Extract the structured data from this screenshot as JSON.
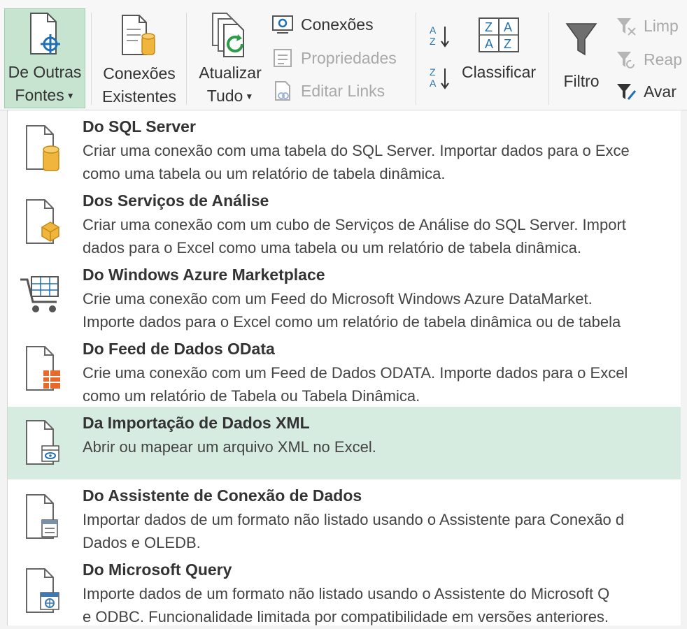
{
  "ribbon": {
    "outras_fontes": {
      "line1": "De Outras",
      "line2": "Fontes"
    },
    "conexoes_existentes": {
      "line1": "Conexões",
      "line2": "Existentes"
    },
    "atualizar_tudo": {
      "line1": "Atualizar",
      "line2": "Tudo"
    },
    "conexoes": "Conexões",
    "propriedades": "Propriedades",
    "editar_links": "Editar Links",
    "classificar": "Classificar",
    "filtro": "Filtro",
    "limpar": "Limp",
    "reaplicar": "Reap",
    "avancado": "Avar"
  },
  "menu": {
    "items": [
      {
        "title": "Do SQL Server",
        "desc1": "Criar uma conexão com uma tabela do SQL Server. Importar dados para o Exce",
        "desc2": "como uma tabela ou um relatório de tabela dinâmica."
      },
      {
        "title": "Dos Serviços de Análise",
        "desc1": "Criar uma conexão com um cubo de Serviços de Análise do SQL Server. Import",
        "desc2": "dados para o Excel como uma tabela ou um relatório de tabela dinâmica."
      },
      {
        "title": "Do Windows Azure Marketplace",
        "desc1": "Crie uma conexão com um Feed do Microsoft Windows Azure DataMarket.",
        "desc2": "Importe dados para o Excel como um relatório de tabela dinâmica ou de tabela"
      },
      {
        "title": "Do Feed de Dados OData",
        "desc1": "Crie uma conexão com um Feed de Dados ODATA. Importe dados para o Excel",
        "desc2": "como um relatório de Tabela ou Tabela Dinâmica."
      },
      {
        "title": "Da Importação de Dados XML",
        "desc1": "Abrir ou mapear um arquivo XML no Excel.",
        "desc2": ""
      },
      {
        "title": "Do Assistente de Conexão de Dados",
        "desc1": "Importar dados de um formato não listado usando o Assistente para Conexão d",
        "desc2": "Dados e OLEDB."
      },
      {
        "title": "Do Microsoft Query",
        "desc1": "Importe dados de um formato não listado usando o Assistente do Microsoft Q",
        "desc2": "e ODBC. Funcionalidade limitada por compatibilidade em versões anteriores."
      }
    ]
  }
}
